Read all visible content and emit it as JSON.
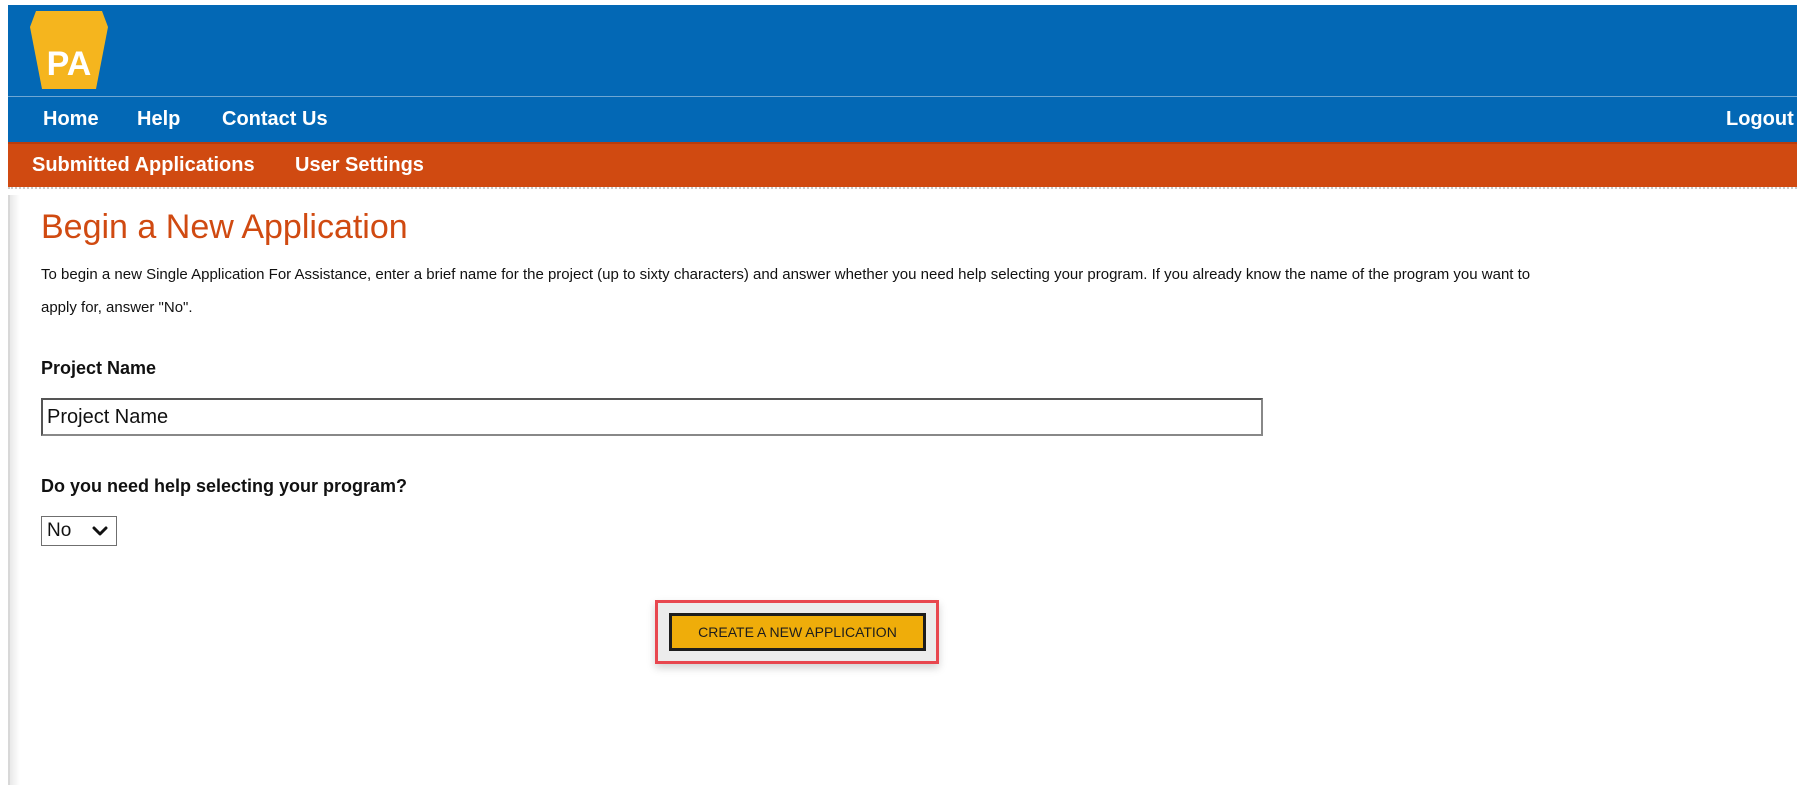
{
  "header": {
    "logo_text": "PA",
    "colors": {
      "header_blue": "#0368b5",
      "nav_orange": "#d04a11",
      "logo_gold": "#f5b51e",
      "button_gold": "#efad0a",
      "highlight_red": "#e8474f"
    }
  },
  "nav": {
    "items": [
      "Home",
      "Help",
      "Contact Us"
    ],
    "logout": "Logout"
  },
  "subnav": {
    "items": [
      "Submitted Applications",
      "User Settings"
    ]
  },
  "main": {
    "title": "Begin a New Application",
    "intro": "To begin a new Single Application For Assistance, enter a brief name for the project (up to sixty characters) and answer whether you need help selecting your program. If you already know the name of the program you want to apply for, answer \"No\".",
    "project_name": {
      "label": "Project Name",
      "value": "Project Name"
    },
    "help_question": {
      "label": "Do you need help selecting your program?",
      "selected": "No",
      "icon": "chevron-down-icon"
    },
    "create_button": "CREATE A NEW APPLICATION"
  }
}
